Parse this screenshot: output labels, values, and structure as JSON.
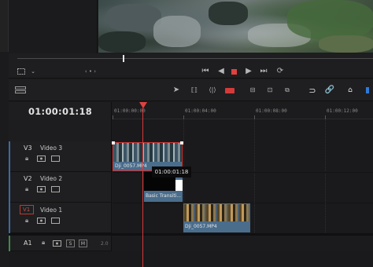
{
  "transport": {
    "view_icon": "view-options-icon",
    "nav_icon": "clip-nav-icon",
    "buttons": [
      "skip-start-icon",
      "step-back-icon",
      "stop-icon",
      "play-icon",
      "skip-end-icon",
      "loop-icon"
    ]
  },
  "toolbar": {
    "tools": [
      "select-icon",
      "trim-icon",
      "dynamic-trim-icon",
      "blade-icon",
      "insert-icon",
      "overwrite-icon",
      "replace-icon",
      "snap-icon",
      "link-icon",
      "flag-icon"
    ]
  },
  "timeline": {
    "current_timecode": "01:00:01:18",
    "ruler_labels": [
      "01:00:00:00",
      "01:00:04:00",
      "01:00:08:00",
      "01:00:12:00"
    ],
    "tooltip_timecode": "01:00:01:18"
  },
  "tracks": [
    {
      "id": "V3",
      "name": "Video 3"
    },
    {
      "id": "V2",
      "name": "Video 2"
    },
    {
      "id": "V1",
      "name": "Video 1"
    },
    {
      "id": "A1",
      "name": "",
      "solo": "S",
      "mute": "M",
      "level": "2.0"
    }
  ],
  "clips": {
    "v3_clip": "Dji_0057.MP4",
    "v2_clip": "Basic Transiti...",
    "v1_clip": "Dji_0057.MP4"
  },
  "colors": {
    "playhead": "#e0413f",
    "clip_blue": "#4a6d8c",
    "accent_blue": "#2f7ad8"
  }
}
